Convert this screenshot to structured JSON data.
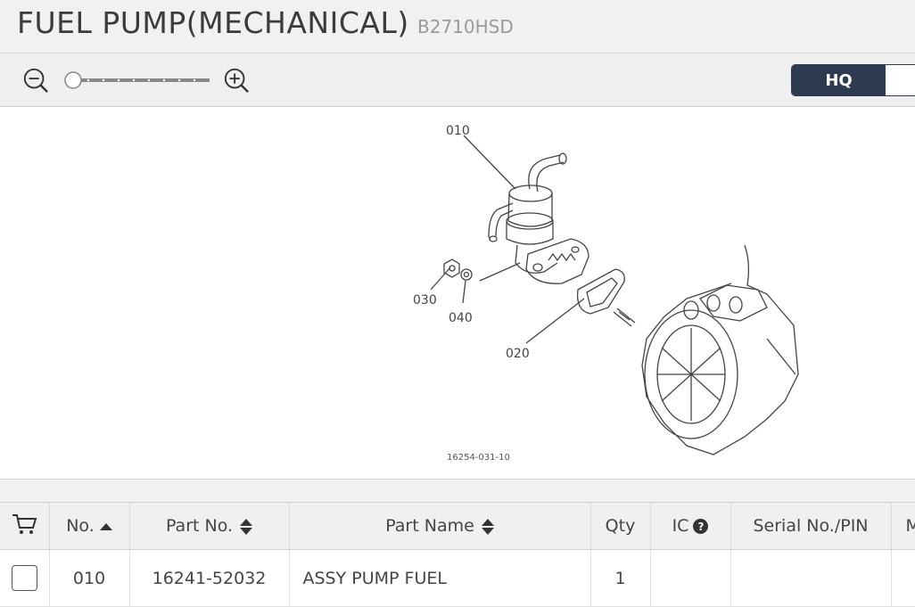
{
  "header": {
    "title": "FUEL PUMP(MECHANICAL)",
    "model": "B2710HSD"
  },
  "toolbar": {
    "zoom_level": 0,
    "hq_label": "HQ"
  },
  "diagram": {
    "callouts": [
      "010",
      "030",
      "040",
      "020"
    ],
    "figure_code": "16254-031-10"
  },
  "table": {
    "columns": [
      "No.",
      "Part No.",
      "Part Name",
      "Qty",
      "IC",
      "Serial No./PIN",
      "M"
    ],
    "rows": [
      {
        "no": "010",
        "part_no": "16241-52032",
        "part_name": "ASSY PUMP FUEL",
        "qty": "1",
        "ic": "",
        "serial": "",
        "m": ""
      }
    ]
  },
  "icons": {
    "zoom_out": "zoom-out-icon",
    "zoom_in": "zoom-in-icon",
    "cart": "cart-icon",
    "help": "question-icon"
  }
}
